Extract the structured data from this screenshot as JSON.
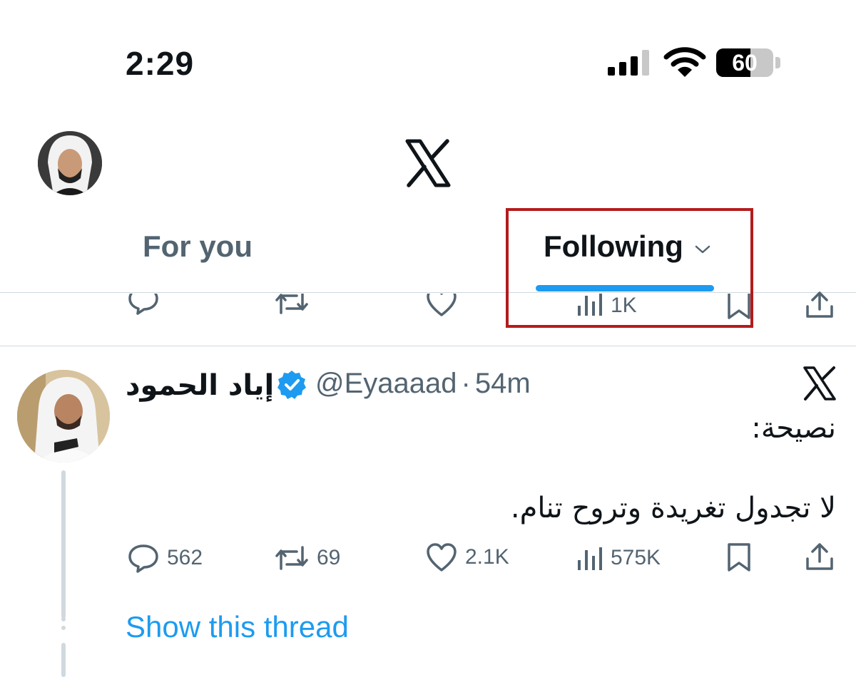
{
  "status_bar": {
    "time": "2:29",
    "battery_level": "60",
    "icons": [
      "signal-icon",
      "wifi-icon",
      "battery-icon"
    ]
  },
  "header": {
    "logo": "x-logo",
    "profile_avatar": "avatar"
  },
  "tabs": [
    {
      "label": "For you",
      "active": false
    },
    {
      "label": "Following",
      "active": true
    }
  ],
  "previous_tweet": {
    "views": "1K"
  },
  "tweet": {
    "author_name": "إياد الحمود",
    "handle": "@Eyaaaad",
    "separator": "·",
    "time": "54m",
    "verified": true,
    "text_line_1": "نصيحة:",
    "text_line_2": "لا تجدول تغريدة وتروح تنام.",
    "replies": "562",
    "reposts": "69",
    "likes": "2.1K",
    "views": "575K",
    "show_thread": "Show this thread"
  },
  "colors": {
    "accent": "#1d9bf0",
    "text_primary": "#0f1419",
    "text_secondary": "#536471",
    "divider": "#cfd9de",
    "highlight_box": "#b31c1c"
  }
}
